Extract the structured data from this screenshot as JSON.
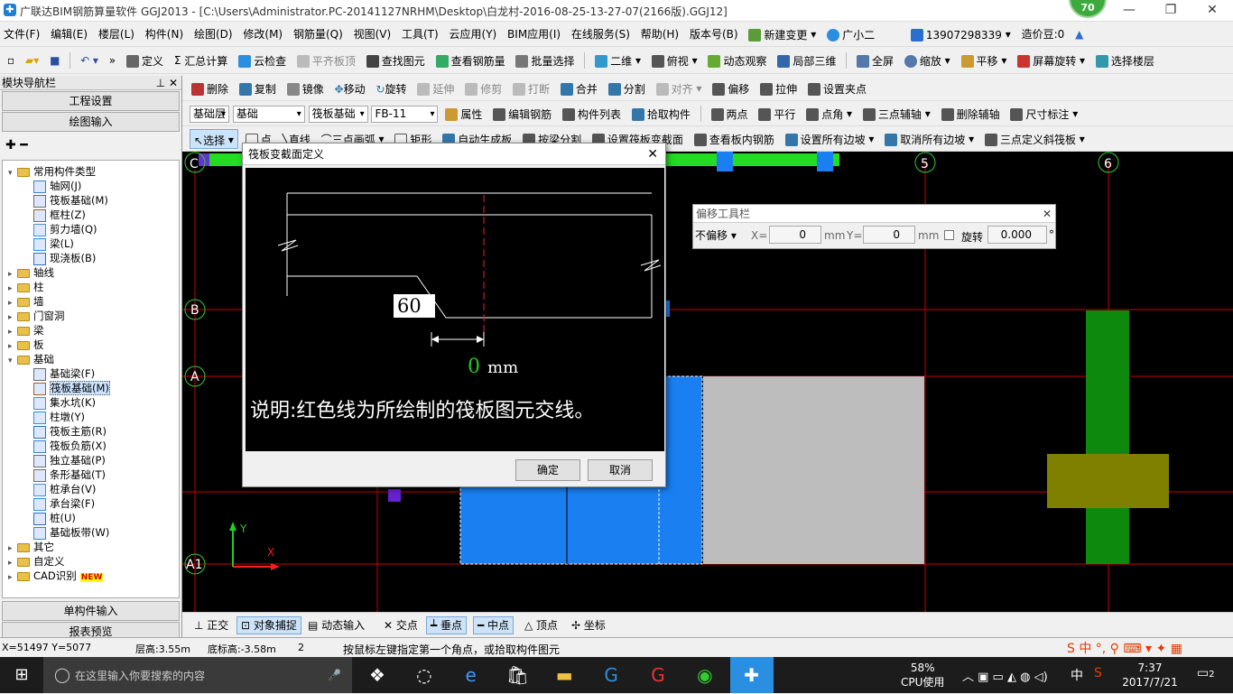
{
  "app": {
    "title": "广联达BIM钢筋算量软件 GGJ2013 - [C:\\Users\\Administrator.PC-20141127NRHM\\Desktop\\白龙村-2016-08-25-13-27-07(2166版).GGJ12]",
    "badge": "70"
  },
  "menu": [
    "文件(F)",
    "编辑(E)",
    "楼层(L)",
    "构件(N)",
    "绘图(D)",
    "修改(M)",
    "钢筋量(Q)",
    "视图(V)",
    "工具(T)",
    "云应用(Y)",
    "BIM应用(I)",
    "在线服务(S)",
    "帮助(H)",
    "版本号(B)",
    "新建变更",
    "广小二"
  ],
  "account": {
    "phone": "13907298339",
    "bean": "造价豆:0"
  },
  "toolbar1": [
    "定义",
    "汇总计算",
    "云检查",
    "平齐板顶",
    "查找图元",
    "查看钢筋量",
    "批量选择",
    "二维",
    "俯视",
    "动态观察",
    "局部三维",
    "全屏",
    "缩放",
    "平移",
    "屏幕旋转",
    "选择楼层"
  ],
  "toolbar2": [
    "删除",
    "复制",
    "镜像",
    "移动",
    "旋转",
    "延伸",
    "修剪",
    "打断",
    "合并",
    "分割",
    "对齐",
    "偏移",
    "拉伸",
    "设置夹点"
  ],
  "toolbar3": {
    "floor": "基础层",
    "category": "基础",
    "type": "筏板基础",
    "name": "FB-11",
    "buttons": [
      "属性",
      "编辑钢筋",
      "构件列表",
      "拾取构件",
      "两点",
      "平行",
      "点角",
      "三点辅轴",
      "删除辅轴",
      "尺寸标注"
    ]
  },
  "toolbar4": [
    "选择",
    "点",
    "直线",
    "三点画弧",
    "矩形",
    "自动生成板",
    "按梁分割",
    "设置筏板变截面",
    "查看板内钢筋",
    "设置所有边坡",
    "取消所有边坡",
    "三点定义斜筏板"
  ],
  "nav": {
    "title": "模块导航栏",
    "btn_project": "工程设置",
    "btn_draw": "绘图输入",
    "btn_single": "单构件输入",
    "btn_report": "报表预览",
    "tree": [
      {
        "label": "常用构件类型",
        "level": 0,
        "folder": true,
        "open": true
      },
      {
        "label": "轴网(J)",
        "level": 1
      },
      {
        "label": "筏板基础(M)",
        "level": 1
      },
      {
        "label": "框柱(Z)",
        "level": 1
      },
      {
        "label": "剪力墙(Q)",
        "level": 1
      },
      {
        "label": "梁(L)",
        "level": 1
      },
      {
        "label": "现浇板(B)",
        "level": 1
      },
      {
        "label": "轴线",
        "level": 0,
        "folder": true
      },
      {
        "label": "柱",
        "level": 0,
        "folder": true
      },
      {
        "label": "墙",
        "level": 0,
        "folder": true
      },
      {
        "label": "门窗洞",
        "level": 0,
        "folder": true
      },
      {
        "label": "梁",
        "level": 0,
        "folder": true
      },
      {
        "label": "板",
        "level": 0,
        "folder": true
      },
      {
        "label": "基础",
        "level": 0,
        "folder": true,
        "open": true
      },
      {
        "label": "基础梁(F)",
        "level": 1
      },
      {
        "label": "筏板基础(M)",
        "level": 1,
        "selected": true
      },
      {
        "label": "集水坑(K)",
        "level": 1
      },
      {
        "label": "柱墩(Y)",
        "level": 1
      },
      {
        "label": "筏板主筋(R)",
        "level": 1
      },
      {
        "label": "筏板负筋(X)",
        "level": 1
      },
      {
        "label": "独立基础(P)",
        "level": 1
      },
      {
        "label": "条形基础(T)",
        "level": 1
      },
      {
        "label": "桩承台(V)",
        "level": 1
      },
      {
        "label": "承台梁(F)",
        "level": 1
      },
      {
        "label": "桩(U)",
        "level": 1
      },
      {
        "label": "基础板带(W)",
        "level": 1
      },
      {
        "label": "其它",
        "level": 0,
        "folder": true
      },
      {
        "label": "自定义",
        "level": 0,
        "folder": true
      },
      {
        "label": "CAD识别",
        "level": 0,
        "folder": true,
        "new": "NEW"
      }
    ]
  },
  "canvas": {
    "axis_labels": [
      "B",
      "A",
      "A1",
      "5",
      "6",
      "C"
    ],
    "x_axis": "X",
    "y_axis": "Y"
  },
  "dialog": {
    "title": "筏板变截面定义",
    "value": "60",
    "offset": "0",
    "unit": "mm",
    "note": "说明:红色线为所绘制的筏板图元交线。",
    "ok": "确定",
    "cancel": "取消"
  },
  "offset_toolbar": {
    "title": "偏移工具栏",
    "mode": "不偏移",
    "x_label": "X=",
    "x_value": "0",
    "y_label": "Y=",
    "y_value": "0",
    "unit": "mm",
    "rotate_label": "旋转",
    "rotate_value": "0.000",
    "deg": "°"
  },
  "snap": [
    "正交",
    "对象捕捉",
    "动态输入",
    "交点",
    "垂点",
    "中点",
    "顶点",
    "坐标"
  ],
  "status": {
    "coords": "X=51497 Y=5077",
    "floor_h": "层高:3.55m",
    "bottom_h": "底标高:-3.58m",
    "num": "2",
    "hint": "按鼠标左键指定第一个角点，或拾取构件图元"
  },
  "taskbar": {
    "search": "在这里输入你要搜索的内容",
    "cpu": "58%",
    "cpu_label": "CPU使用",
    "ime": "中",
    "time": "7:37",
    "date": "2017/7/21",
    "notif": "2"
  }
}
